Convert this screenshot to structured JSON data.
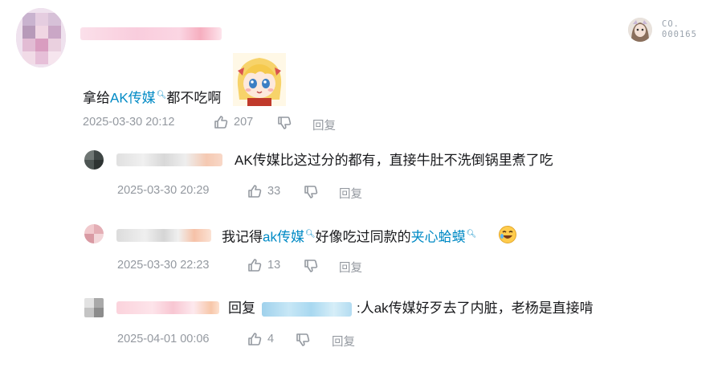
{
  "main_comment": {
    "text_prefix": "拿给",
    "link_text": "AK传媒",
    "text_suffix": "都不吃啊",
    "date": "2025-03-30 20:12",
    "likes": "207",
    "reply_label": "回复"
  },
  "badge": {
    "line1": "CO.",
    "line2": "000165"
  },
  "replies": [
    {
      "text": "AK传媒比这过分的都有，直接牛肚不洗倒锅里煮了吃",
      "date": "2025-03-30 20:29",
      "likes": "33",
      "reply_label": "回复"
    },
    {
      "text_prefix": "我记得",
      "link1": "ak传媒",
      "text_middle": "好像吃过同款的",
      "link2": "夹心蛤蟆",
      "date": "2025-03-30 22:23",
      "likes": "13",
      "reply_label": "回复"
    },
    {
      "prefix": "回复",
      "text": ":人ak传媒好歹去了内脏，老杨是直接啃",
      "date": "2025-04-01 00:06",
      "likes": "4",
      "reply_label": "回复"
    }
  ],
  "colors": {
    "link": "#008ac5",
    "meta": "#9499a0",
    "text": "#18191c"
  }
}
